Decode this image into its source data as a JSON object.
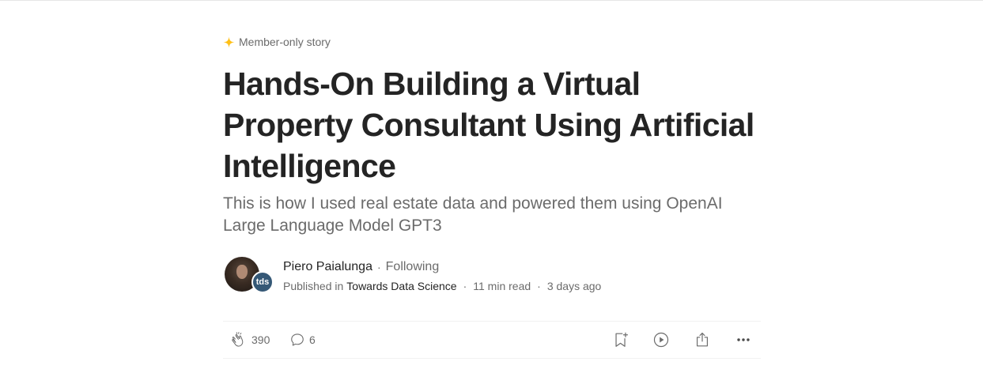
{
  "member_label": "Member-only story",
  "title": "Hands-On Building a Virtual Property Consultant Using Artificial Intelligence",
  "subtitle": "This is how I used real estate data and powered them using OpenAI Large Language Model GPT3",
  "author": {
    "name": "Piero Paialunga",
    "separator": "·",
    "follow_status": "Following"
  },
  "publication": {
    "prefix": "Published in",
    "name": "Towards Data Science",
    "badge_text": "tds",
    "read_time": "11 min read",
    "posted": "3 days ago",
    "separator": "·"
  },
  "actions": {
    "claps": "390",
    "responses": "6"
  },
  "colors": {
    "accent_star": "#FFC017",
    "text_primary": "#242424",
    "text_secondary": "#6B6B6B",
    "publication_badge": "#355876"
  },
  "icons": [
    "star-icon",
    "clap-icon",
    "comment-icon",
    "bookmark-add-icon",
    "play-icon",
    "share-icon",
    "more-icon"
  ]
}
